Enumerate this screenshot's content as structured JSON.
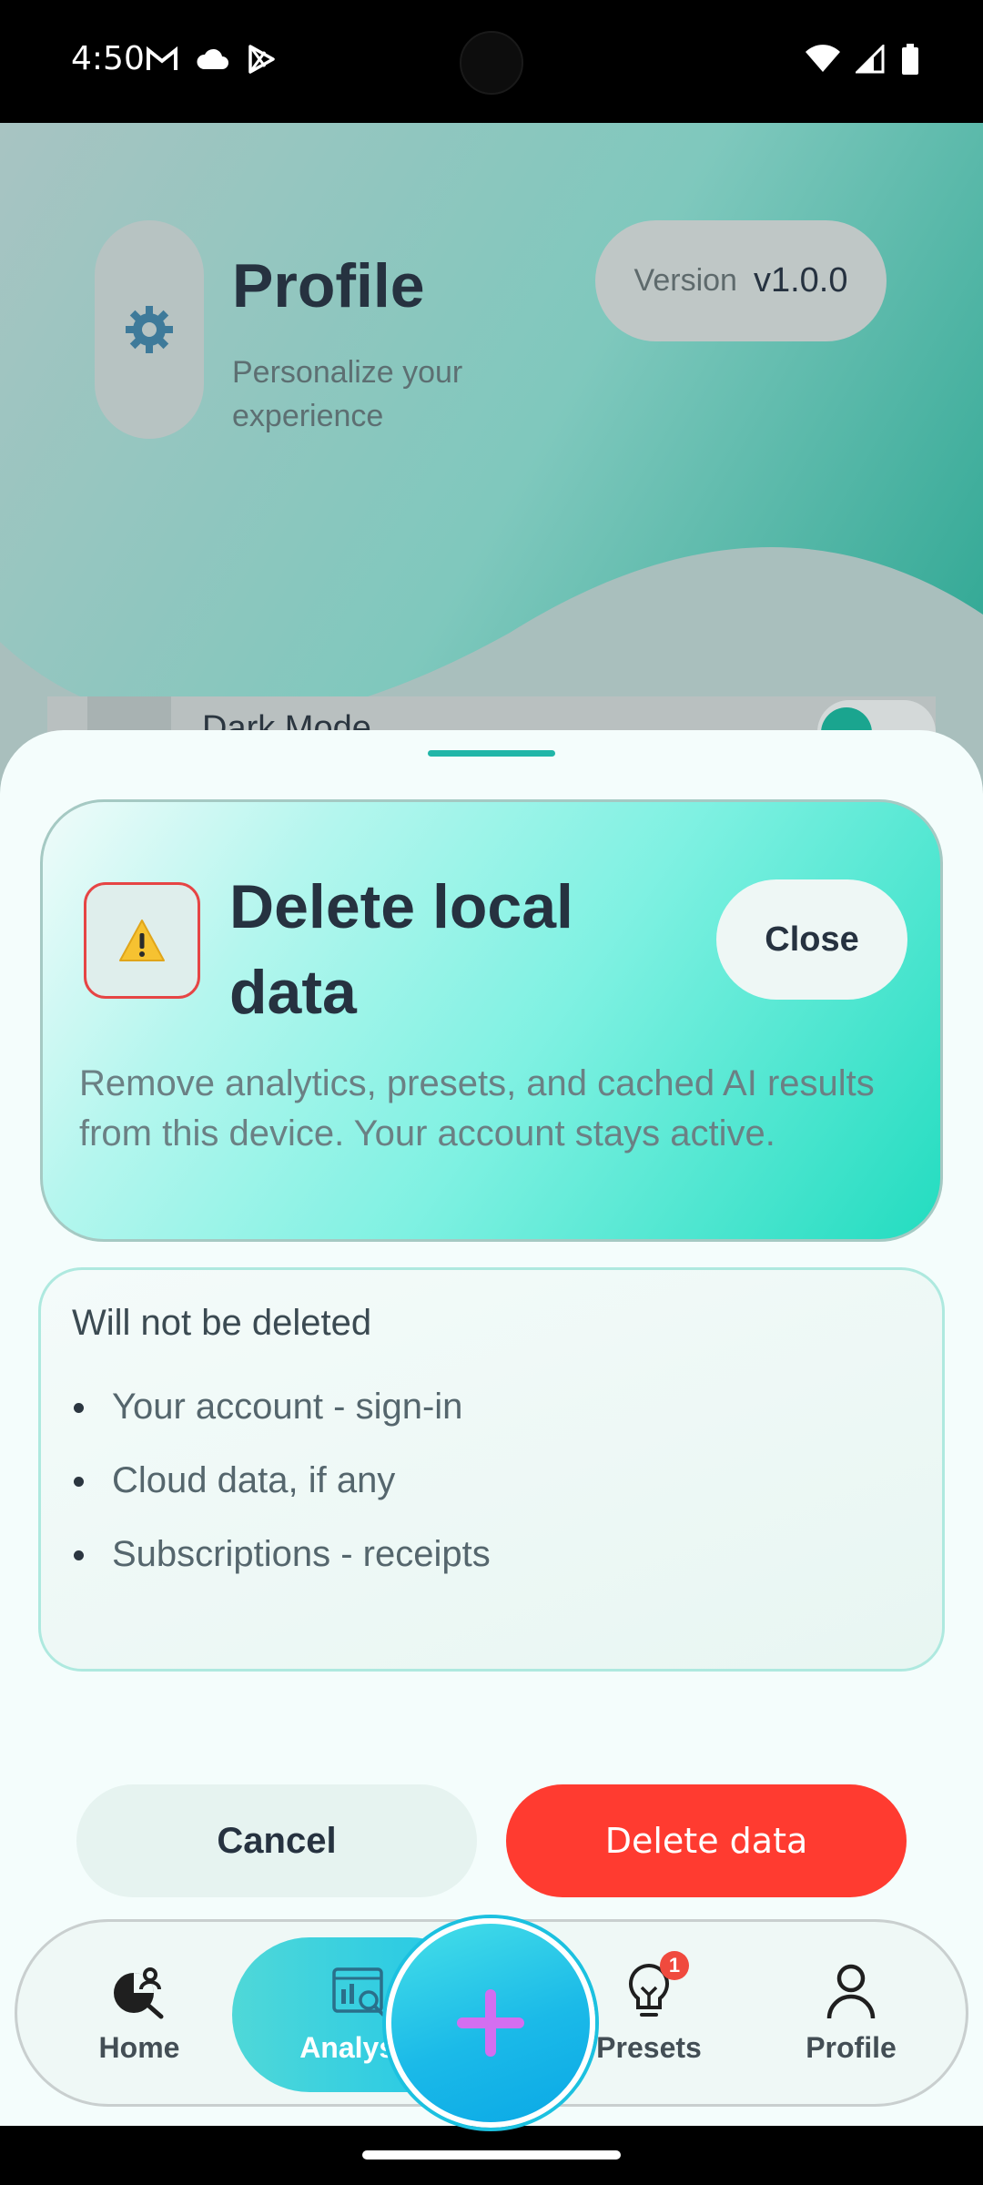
{
  "status_bar": {
    "time": "4:50"
  },
  "background": {
    "title": "Profile",
    "subtitle": "Personalize your experience",
    "version_label": "Version",
    "version_value": "v1.0.0",
    "dark_mode_label": "Dark Mode"
  },
  "dialog": {
    "title": "Delete local data",
    "close_label": "Close",
    "description": "Remove analytics, presets, and cached AI results from this device. Your account stays active.",
    "keep_title": "Will not be deleted",
    "keep_items": [
      "Your account - sign-in",
      "Cloud data, if any",
      "Subscriptions - receipts"
    ],
    "cancel_label": "Cancel",
    "delete_label": "Delete data"
  },
  "nav": {
    "items": [
      {
        "label": "Home",
        "icon": "analysis-person-icon"
      },
      {
        "label": "Analysis",
        "icon": "chart-search-icon",
        "active": true
      },
      {
        "label": "Presets",
        "icon": "lightbulb-icon",
        "badge": "1"
      },
      {
        "label": "Profile",
        "icon": "person-icon"
      }
    ],
    "fab_icon": "plus-icon"
  },
  "colors": {
    "accent": "#1fc6e8",
    "danger": "#ff3b30",
    "text_dark": "#263240",
    "plus": "#d36ef0"
  }
}
